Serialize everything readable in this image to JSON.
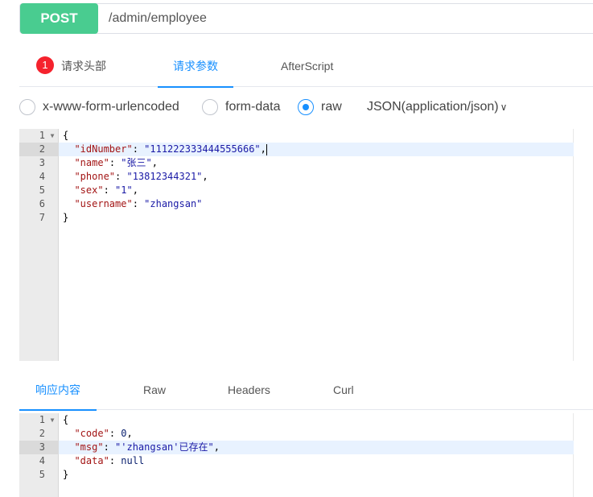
{
  "request": {
    "method": "POST",
    "url": "/admin/employee"
  },
  "request_tabs": [
    {
      "label": "请求头部",
      "badge": "1",
      "active": false
    },
    {
      "label": "请求参数",
      "active": true
    },
    {
      "label": "AfterScript",
      "active": false
    }
  ],
  "body_types": [
    {
      "label": "x-www-form-urlencoded",
      "checked": false
    },
    {
      "label": "form-data",
      "checked": false
    },
    {
      "label": "raw",
      "checked": true
    }
  ],
  "content_type": "JSON(application/json)",
  "content_type_caret": "∨",
  "request_body": {
    "line_numbers": [
      "1",
      "2",
      "3",
      "4",
      "5",
      "6",
      "7"
    ],
    "open_brace": "{",
    "close_brace": "}",
    "fields": [
      {
        "key": "\"idNumber\"",
        "value": "\"111222333444555666\"",
        "sep": ","
      },
      {
        "key": "\"name\"",
        "value": "\"张三\"",
        "sep": ","
      },
      {
        "key": "\"phone\"",
        "value": "\"13812344321\"",
        "sep": ","
      },
      {
        "key": "\"sex\"",
        "value": "\"1\"",
        "sep": ","
      },
      {
        "key": "\"username\"",
        "value": "\"zhangsan\"",
        "sep": ""
      }
    ]
  },
  "response_tabs": [
    {
      "label": "响应内容",
      "active": true
    },
    {
      "label": "Raw",
      "active": false
    },
    {
      "label": "Headers",
      "active": false
    },
    {
      "label": "Curl",
      "active": false
    }
  ],
  "response_body": {
    "line_numbers": [
      "1",
      "2",
      "3",
      "4",
      "5"
    ],
    "open_brace": "{",
    "close_brace": "}",
    "fields": [
      {
        "key": "\"code\"",
        "value": "0",
        "sep": ","
      },
      {
        "key": "\"msg\"",
        "value": "\"'zhangsan'已存在\"",
        "sep": ","
      },
      {
        "key": "\"data\"",
        "value": "null",
        "sep": ""
      }
    ]
  },
  "colors": {
    "method_bg": "#49cc90",
    "accent": "#1890ff",
    "badge_bg": "#f5222d"
  },
  "icons": {
    "fold": "fold-arrow-icon",
    "dropdown": "chevron-down-icon"
  }
}
